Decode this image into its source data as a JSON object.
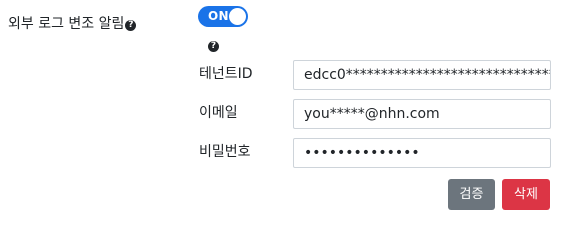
{
  "notification": {
    "label": "외부 로그 변조 알림",
    "help_icon": "?",
    "toggle_label": "ON",
    "toggle_on": true,
    "standalone_help_icon": "?"
  },
  "fields": {
    "tenant_id": {
      "label": "테넌트ID",
      "value": "edcc0******************************"
    },
    "email": {
      "label": "이메일",
      "value": "you*****@nhn.com"
    },
    "password": {
      "label": "비밀번호",
      "value": "••••••••••••••"
    }
  },
  "actions": {
    "verify_label": "검증",
    "delete_label": "삭제"
  },
  "colors": {
    "toggle_on": "#1a73e8",
    "verify_button": "#6c757d",
    "delete_button": "#dc3545"
  }
}
